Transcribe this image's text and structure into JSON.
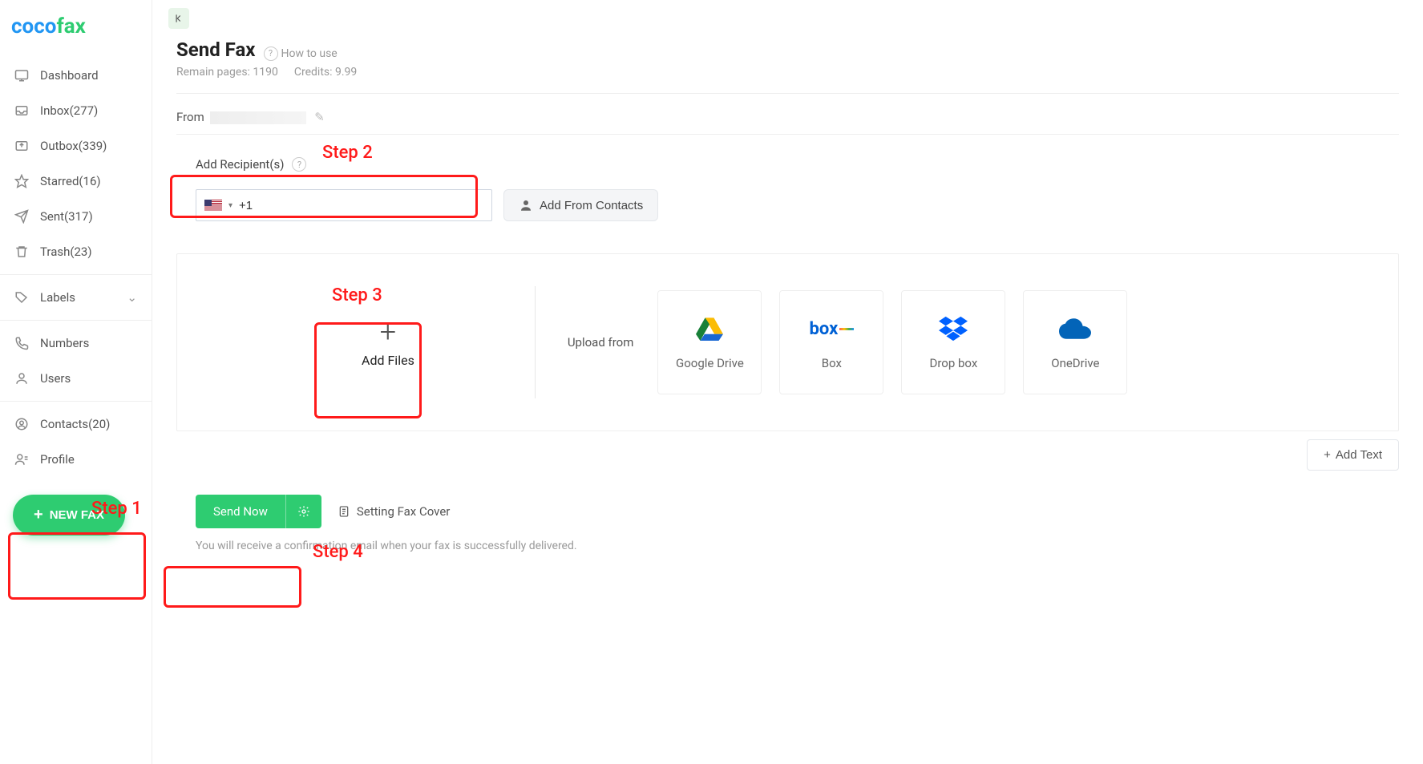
{
  "logo": {
    "part1": "coco",
    "part2": "fax"
  },
  "sidebar": {
    "dashboard": "Dashboard",
    "inbox": "Inbox(277)",
    "outbox": "Outbox(339)",
    "starred": "Starred(16)",
    "sent": "Sent(317)",
    "trash": "Trash(23)",
    "labels": "Labels",
    "numbers": "Numbers",
    "users": "Users",
    "contacts": "Contacts(20)",
    "profile": "Profile",
    "new_fax": "NEW FAX"
  },
  "page": {
    "title": "Send Fax",
    "how_to": "How to use",
    "remain": "Remain pages: 1190",
    "credits": "Credits: 9.99",
    "from_label": "From"
  },
  "recipients": {
    "label": "Add Recipient(s)",
    "dial_prefix": "+1",
    "add_from_contacts": "Add From Contacts"
  },
  "files": {
    "add_files": "Add Files",
    "upload_from": "Upload from",
    "google_drive": "Google Drive",
    "box": "Box",
    "dropbox": "Drop box",
    "onedrive": "OneDrive",
    "add_text": "Add Text"
  },
  "send": {
    "send_now": "Send Now",
    "setting_cover": "Setting Fax Cover",
    "confirm_note": "You will receive a confirmation email when your fax is successfully delivered."
  },
  "annotations": {
    "step1": "Step 1",
    "step2": "Step 2",
    "step3": "Step 3",
    "step4": "Step 4"
  }
}
